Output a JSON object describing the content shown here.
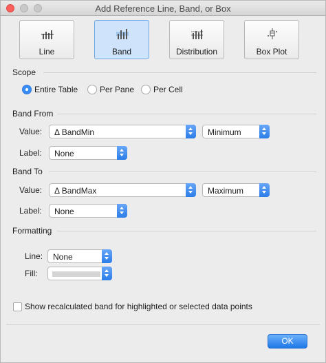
{
  "window": {
    "title": "Add Reference Line, Band, or Box"
  },
  "types": [
    {
      "label": "Line",
      "icon": "reference-line-icon",
      "active": false
    },
    {
      "label": "Band",
      "icon": "reference-band-icon",
      "active": true
    },
    {
      "label": "Distribution",
      "icon": "distribution-icon",
      "active": false
    },
    {
      "label": "Box Plot",
      "icon": "box-plot-icon",
      "active": false
    }
  ],
  "scope": {
    "heading": "Scope",
    "options": [
      "Entire Table",
      "Per Pane",
      "Per Cell"
    ],
    "selected": "Entire Table"
  },
  "band_from": {
    "heading": "Band From",
    "value_label": "Value:",
    "value": "Δ  BandMin",
    "aggregation": "Minimum",
    "label_label": "Label:",
    "label_value": "None"
  },
  "band_to": {
    "heading": "Band To",
    "value_label": "Value:",
    "value": "Δ  BandMax",
    "aggregation": "Maximum",
    "label_label": "Label:",
    "label_value": "None"
  },
  "formatting": {
    "heading": "Formatting",
    "line_label": "Line:",
    "line_value": "None",
    "fill_label": "Fill:",
    "fill_color": "#d5d5d5"
  },
  "options": {
    "show_recalculated": "Show recalculated band for highlighted or selected data points",
    "checked": false
  },
  "footer": {
    "ok_label": "OK"
  },
  "colors": {
    "accent": "#3b8df3",
    "active_tile": "#cfe4fb"
  }
}
